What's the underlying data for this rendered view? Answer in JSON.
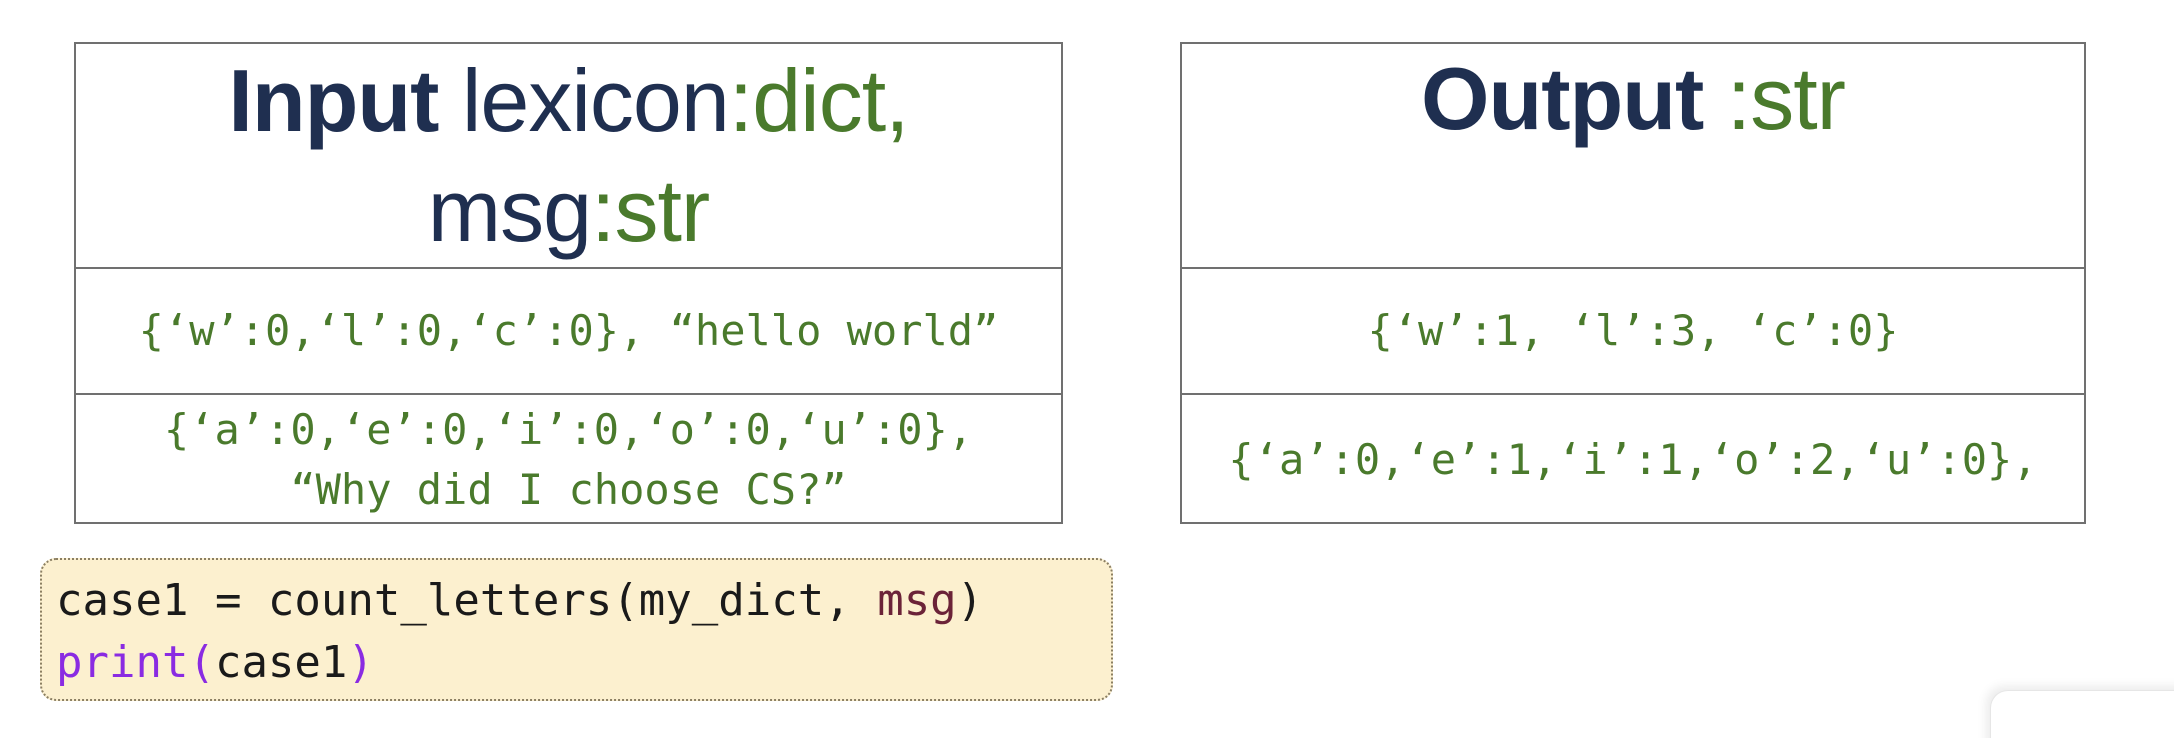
{
  "input_table": {
    "header": {
      "keyword": "Input",
      "param1_name": " lexicon",
      "param1_type": ":dict,",
      "param2_name": "msg",
      "param2_type": ":str"
    },
    "rows": [
      "{‘w’:0,‘l’:0,‘c’:0}, “hello world”",
      "{‘a’:0,‘e’:0,‘i’:0,‘o’:0,‘u’:0},\n“Why did I choose CS?”"
    ]
  },
  "output_table": {
    "header": {
      "keyword": "Output",
      "type": " :str"
    },
    "rows": [
      "{‘w’:1, ‘l’:3, ‘c’:0}",
      "{‘a’:0,‘e’:1,‘i’:1,‘o’:2,‘u’:0},"
    ]
  },
  "code": {
    "line1_pre": "case1 = count_letters(my_dict, ",
    "line1_var": "msg",
    "line1_post": ")",
    "line2_fn": "print(",
    "line2_arg": "case1",
    "line2_close": ")"
  },
  "colors": {
    "heading": "#1f2f50",
    "type": "#4a7a2c",
    "code_bg": "#fcf0cf",
    "builtin": "#8a2be2"
  }
}
